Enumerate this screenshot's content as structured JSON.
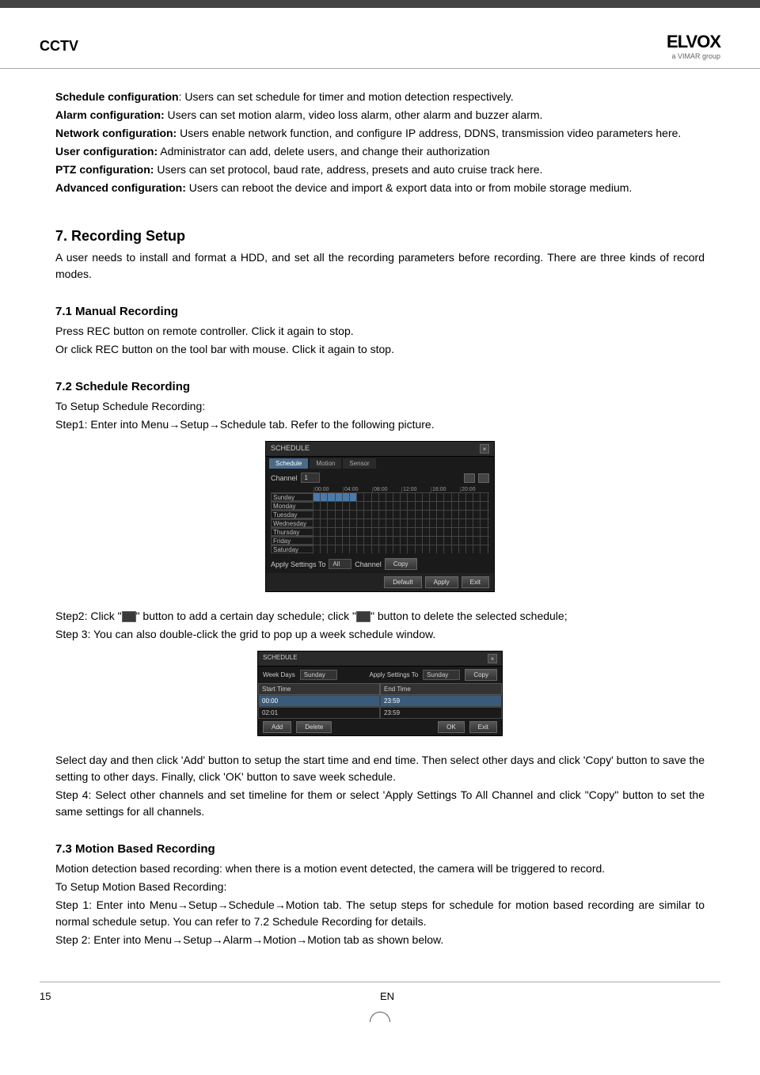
{
  "header": {
    "title": "CCTV",
    "logo_main": "ELVOX",
    "logo_sub": "a VIMAR group"
  },
  "configs": {
    "schedule_label": "Schedule configuration",
    "schedule_text": ": Users can set schedule for timer and motion detection respectively.",
    "alarm_label": "Alarm configuration:",
    "alarm_text": " Users can set motion alarm, video loss alarm, other alarm and buzzer alarm.",
    "network_label": "Network configuration:",
    "network_text": " Users enable network function, and configure IP address, DDNS, transmission video parameters here.",
    "user_label": "User configuration:",
    "user_text": " Administrator can add, delete users, and change their authorization",
    "ptz_label": "PTZ configuration:",
    "ptz_text": " Users can set protocol, baud rate, address, presets and auto cruise track here.",
    "advanced_label": "Advanced configuration:",
    "advanced_text": " Users can reboot the device and import & export data into or from mobile storage medium."
  },
  "s7": {
    "heading": "7.   Recording Setup",
    "intro": "A user needs to install and format a HDD, and set all the recording parameters before recording. There are three kinds of record modes."
  },
  "s71": {
    "heading": "7.1   Manual Recording",
    "p1": "Press REC button on remote controller. Click it again to stop.",
    "p2": "Or click REC button on the tool bar with mouse. Click it again to stop."
  },
  "s72": {
    "heading": "7.2   Schedule Recording",
    "p1": "To Setup Schedule Recording:",
    "p2": "Step1: Enter into Menu→Setup→Schedule tab. Refer to the following picture.",
    "p3a": "Step2: Click \"",
    "p3b": "\" button to add a certain day schedule; click \"",
    "p3c": "\" button to delete the selected schedule;",
    "p4": "Step 3: You can also double-click the grid to pop up a week schedule window.",
    "p5": "Select day and then click 'Add' button to setup the start time and end time. Then select other days and click 'Copy' button to save the setting to other days. Finally, click 'OK' button to save week schedule.",
    "p6": "Step 4: Select other channels and set timeline for them or select 'Apply Settings To All Channel and click \"Copy\" button to set the same settings for all channels."
  },
  "s73": {
    "heading": "7.3  Motion Based Recording",
    "p1": "Motion detection based recording: when there is a motion event detected, the camera will be triggered to record.",
    "p2": "To Setup Motion Based Recording:",
    "p3": "Step 1: Enter into Menu→Setup→Schedule→Motion tab. The setup steps for schedule for motion based recording are similar to normal schedule setup. You can refer to 7.2 Schedule Recording for details.",
    "p4": "Step 2: Enter into Menu→Setup→Alarm→Motion→Motion tab as shown below."
  },
  "schedule_dialog": {
    "title": "SCHEDULE",
    "tabs": [
      "Schedule",
      "Motion",
      "Sensor"
    ],
    "channel_label": "Channel",
    "channel_value": "1",
    "time_headers": [
      "00:00",
      "04:00",
      "08:00",
      "12:00",
      "16:00",
      "20:00"
    ],
    "days": [
      "Sunday",
      "Monday",
      "Tuesday",
      "Wednesday",
      "Thursday",
      "Friday",
      "Saturday"
    ],
    "apply_label": "Apply Settings To",
    "apply_value": "All",
    "apply_ch_label": "Channel",
    "copy_btn": "Copy",
    "default_btn": "Default",
    "apply_btn": "Apply",
    "exit_btn": "Exit"
  },
  "week_dialog": {
    "title": "SCHEDULE",
    "weekdays_label": "Week Days",
    "weekdays_value": "Sunday",
    "apply_label": "Apply Settings To",
    "apply_value": "Sunday",
    "copy_btn": "Copy",
    "start_label": "Start Time",
    "end_label": "End Time",
    "rows": [
      {
        "start": "00:00",
        "end": "23:59"
      },
      {
        "start": "02:01",
        "end": "23:59"
      }
    ],
    "add_btn": "Add",
    "delete_btn": "Delete",
    "ok_btn": "OK",
    "exit_btn": "Exit"
  },
  "footer": {
    "page": "15",
    "lang": "EN"
  }
}
